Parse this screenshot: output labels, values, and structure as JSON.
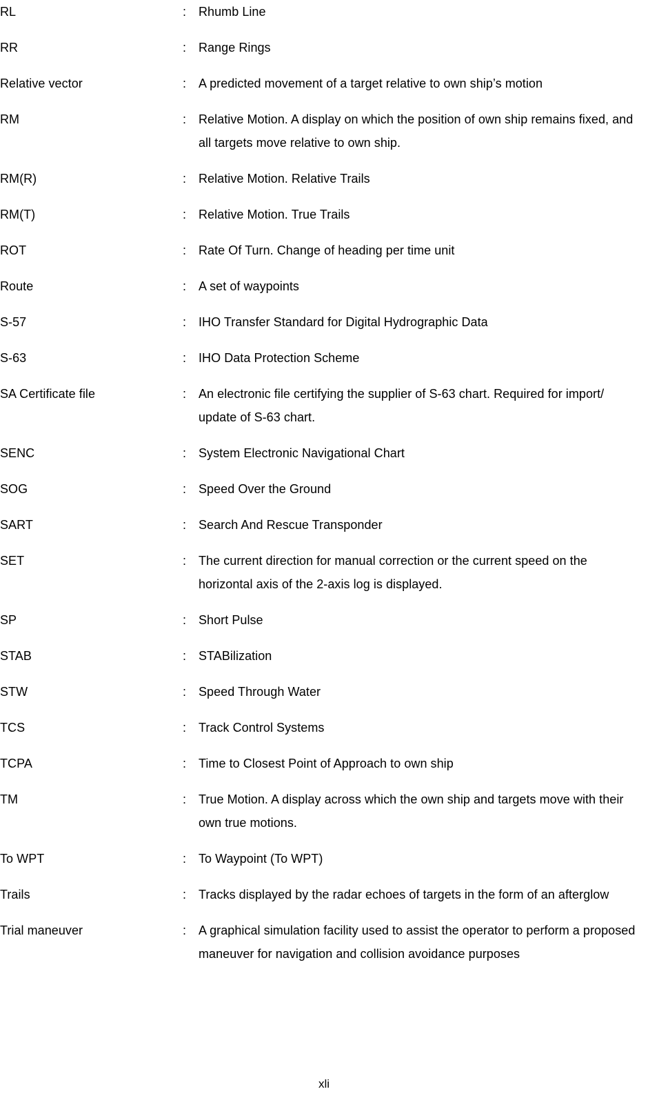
{
  "document": {
    "type": "glossary",
    "page_number": "xli",
    "separator": ":",
    "entries": [
      {
        "term": "RL",
        "definition": "Rhumb Line"
      },
      {
        "term": "RR",
        "definition": "Range Rings"
      },
      {
        "term": "Relative vector",
        "definition": "A predicted movement of a target relative to own ship’s motion"
      },
      {
        "term": "RM",
        "definition": "Relative Motion. A display on which the position of own ship remains fixed, and all targets move relative to own ship."
      },
      {
        "term": "RM(R)",
        "definition": "Relative Motion. Relative Trails"
      },
      {
        "term": "RM(T)",
        "definition": "Relative Motion. True Trails"
      },
      {
        "term": "ROT",
        "definition": "Rate Of Turn. Change of heading per time unit"
      },
      {
        "term": "Route",
        "definition": "A set of waypoints"
      },
      {
        "term": "S-57",
        "definition": "IHO Transfer Standard for Digital Hydrographic Data"
      },
      {
        "term": "S-63",
        "definition": "IHO Data Protection Scheme"
      },
      {
        "term": "SA Certificate file",
        "definition": "An electronic file certifying the supplier of S-63 chart. Required for import/ update of S-63 chart."
      },
      {
        "term": "SENC",
        "definition": "System Electronic Navigational Chart"
      },
      {
        "term": "SOG",
        "definition": "Speed Over the Ground"
      },
      {
        "term": "SART",
        "definition": "Search And Rescue Transponder"
      },
      {
        "term": "SET",
        "definition": "The current direction for manual correction or the current speed on the horizontal axis of the 2-axis log is displayed."
      },
      {
        "term": "SP",
        "definition": "Short Pulse"
      },
      {
        "term": "STAB",
        "definition": "STABilization"
      },
      {
        "term": "STW",
        "definition": "Speed Through Water"
      },
      {
        "term": "TCS",
        "definition": "Track Control Systems"
      },
      {
        "term": "TCPA",
        "definition": "Time to Closest Point of Approach to own ship"
      },
      {
        "term": "TM",
        "definition": "True Motion. A display across which the own ship and targets move with their own true motions."
      },
      {
        "term": "To WPT",
        "definition": "To Waypoint (To WPT)"
      },
      {
        "term": "Trails",
        "definition": "Tracks displayed by the radar echoes of targets in the form of an afterglow"
      },
      {
        "term": "Trial maneuver",
        "definition": "A graphical simulation facility used to assist the operator to perform a proposed maneuver for navigation and collision avoidance purposes"
      }
    ]
  }
}
